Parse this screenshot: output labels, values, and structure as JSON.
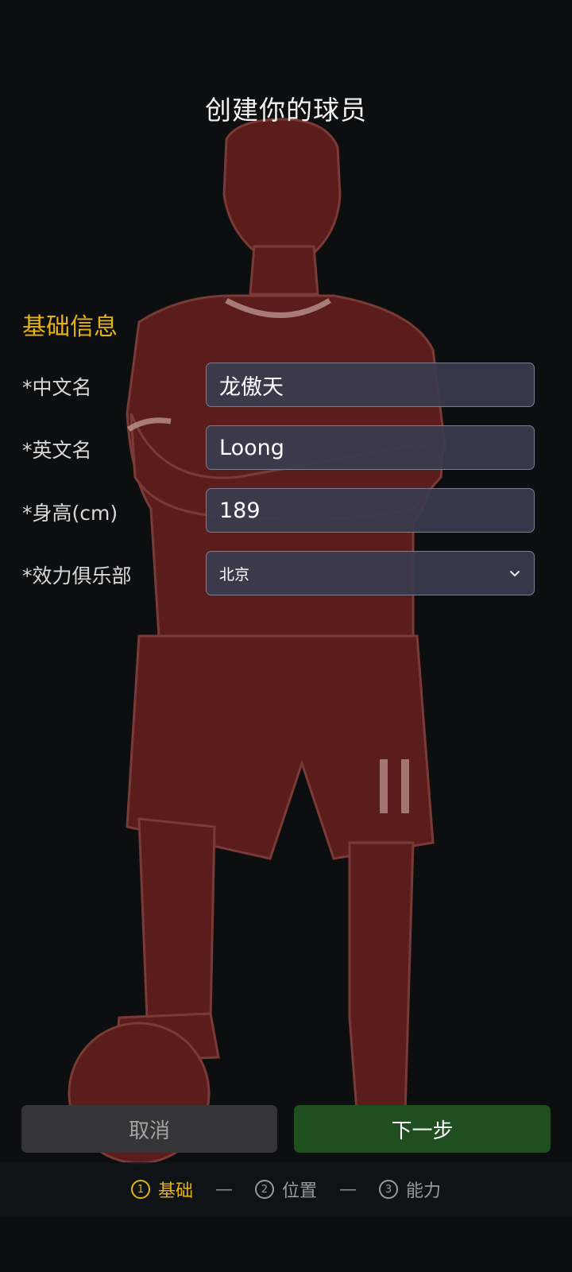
{
  "header": {
    "title": "创建你的球员"
  },
  "section": {
    "title": "基础信息"
  },
  "form": {
    "chinese_name": {
      "label": "*中文名",
      "value": "龙傲天"
    },
    "english_name": {
      "label": "*英文名",
      "value": "Loong"
    },
    "height": {
      "label": "*身高(cm)",
      "value": "189"
    },
    "club": {
      "label": "*效力俱乐部",
      "selected": "北京"
    }
  },
  "buttons": {
    "cancel": "取消",
    "next": "下一步"
  },
  "steps": [
    {
      "num": "1",
      "label": "基础",
      "active": true
    },
    {
      "num": "2",
      "label": "位置",
      "active": false
    },
    {
      "num": "3",
      "label": "能力",
      "active": false
    }
  ],
  "step_separator": "—",
  "colors": {
    "accent": "#e6b311",
    "next_button": "#1f4e1f",
    "cancel_button": "#353538",
    "field_bg": "#3a3c4e",
    "silhouette": "#5a1d1c"
  }
}
